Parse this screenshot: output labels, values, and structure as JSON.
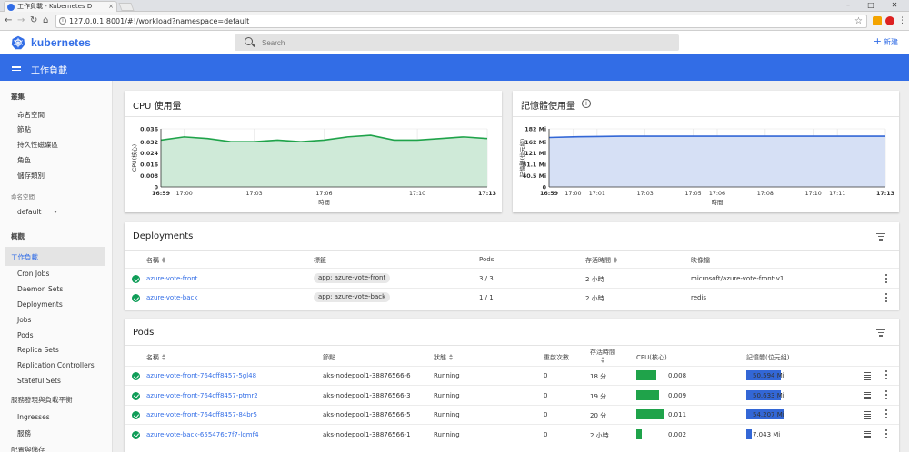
{
  "browser": {
    "tab_title": "工作負載 - Kubernetes D",
    "url": "127.0.0.1:8001/#!/workload?namespace=default",
    "icons": [
      "back-icon",
      "forward-icon",
      "reload-icon",
      "home-icon",
      "star-icon",
      "extension-icon",
      "opera-icon",
      "menu-icon"
    ]
  },
  "header": {
    "brand": "kubernetes",
    "search_placeholder": "Search",
    "new_label": "新建"
  },
  "titlebar": {
    "title": "工作負載"
  },
  "sidebar": {
    "cluster_heading": "叢集",
    "cluster_items": [
      "命名空間",
      "節點",
      "持久性磁碟區",
      "角色",
      "儲存類別"
    ],
    "namespace_label": "命名空間",
    "namespace_value": "default",
    "overview": "概觀",
    "workloads": "工作負載",
    "workload_items": [
      "Cron Jobs",
      "Daemon Sets",
      "Deployments",
      "Jobs",
      "Pods",
      "Replica Sets",
      "Replication Controllers",
      "Stateful Sets"
    ],
    "discovery_heading": "服務發現與負載平衡",
    "discovery_items": [
      "Ingresses",
      "服務"
    ],
    "config_heading": "配置與儲存"
  },
  "cpu_card": {
    "title": "CPU 使用量"
  },
  "mem_card": {
    "title": "記憶體使用量"
  },
  "chart_data": [
    {
      "type": "area",
      "title": "CPU 使用量",
      "xlabel": "時間",
      "ylabel": "CPU(核心)",
      "x": [
        "16:59",
        "17:00",
        "17:01",
        "17:02",
        "17:03",
        "17:04",
        "17:05",
        "17:06",
        "17:07",
        "17:08",
        "17:09",
        "17:10",
        "17:11",
        "17:12",
        "17:13"
      ],
      "x_ticks": [
        "16:59",
        "17:00",
        "17:03",
        "17:06",
        "17:10",
        "17:13"
      ],
      "y_ticks": [
        "0",
        "0.008",
        "0.016",
        "0.024",
        "0.032",
        "0.036"
      ],
      "ylim": [
        0,
        0.036
      ],
      "series": [
        {
          "values": [
            0.029,
            0.031,
            0.03,
            0.028,
            0.028,
            0.029,
            0.028,
            0.029,
            0.031,
            0.032,
            0.029,
            0.029,
            0.03,
            0.031,
            0.03
          ]
        }
      ],
      "color": "#1fa34a"
    },
    {
      "type": "area",
      "title": "記憶體使用量",
      "xlabel": "時間",
      "ylabel": "記憶體(位元組)",
      "x": [
        "16:59",
        "17:00",
        "17:01",
        "17:02",
        "17:03",
        "17:04",
        "17:05",
        "17:06",
        "17:07",
        "17:08",
        "17:09",
        "17:10",
        "17:11",
        "17:12",
        "17:13"
      ],
      "x_ticks": [
        "16:59",
        "17:00",
        "17:01",
        "17:03",
        "17:05",
        "17:06",
        "17:08",
        "17:10",
        "17:11",
        "17:13"
      ],
      "y_ticks": [
        "0",
        "40.5 Mi",
        "81.1 Mi",
        "121 Mi",
        "162 Mi",
        "182 Mi"
      ],
      "ylim": [
        0,
        182
      ],
      "series": [
        {
          "values": [
            155,
            157,
            158,
            159,
            159,
            159,
            159,
            159,
            159,
            159,
            159,
            159,
            159,
            159,
            159
          ]
        }
      ],
      "color": "#3367d6"
    }
  ],
  "deployments": {
    "title": "Deployments",
    "columns": [
      "名稱",
      "標籤",
      "Pods",
      "存活時間",
      "映像檔"
    ],
    "rows": [
      {
        "name": "azure-vote-front",
        "label": "app: azure-vote-front",
        "pods": "3 / 3",
        "age": "2 小時",
        "image": "microsoft/azure-vote-front:v1"
      },
      {
        "name": "azure-vote-back",
        "label": "app: azure-vote-back",
        "pods": "1 / 1",
        "age": "2 小時",
        "image": "redis"
      }
    ]
  },
  "pods": {
    "title": "Pods",
    "columns": [
      "名稱",
      "節點",
      "狀態",
      "重啟次數",
      "存活時間",
      "CPU(核心)",
      "記憶體(位元組)"
    ],
    "rows": [
      {
        "name": "azure-vote-front-764cff8457-5gl48",
        "node": "aks-nodepool1-38876566-6",
        "status": "Running",
        "restarts": "0",
        "age": "18 分",
        "cpu": "0.008",
        "mem": "50.594 Mi"
      },
      {
        "name": "azure-vote-front-764cff8457-ptmr2",
        "node": "aks-nodepool1-38876566-3",
        "status": "Running",
        "restarts": "0",
        "age": "19 分",
        "cpu": "0.009",
        "mem": "50.633 Mi"
      },
      {
        "name": "azure-vote-front-764cff8457-84br5",
        "node": "aks-nodepool1-38876566-5",
        "status": "Running",
        "restarts": "0",
        "age": "20 分",
        "cpu": "0.011",
        "mem": "54.207 Mi"
      },
      {
        "name": "azure-vote-back-655476c7f7-lqmf4",
        "node": "aks-nodepool1-38876566-1",
        "status": "Running",
        "restarts": "0",
        "age": "2 小時",
        "cpu": "0.002",
        "mem": "7.043 Mi"
      }
    ]
  }
}
